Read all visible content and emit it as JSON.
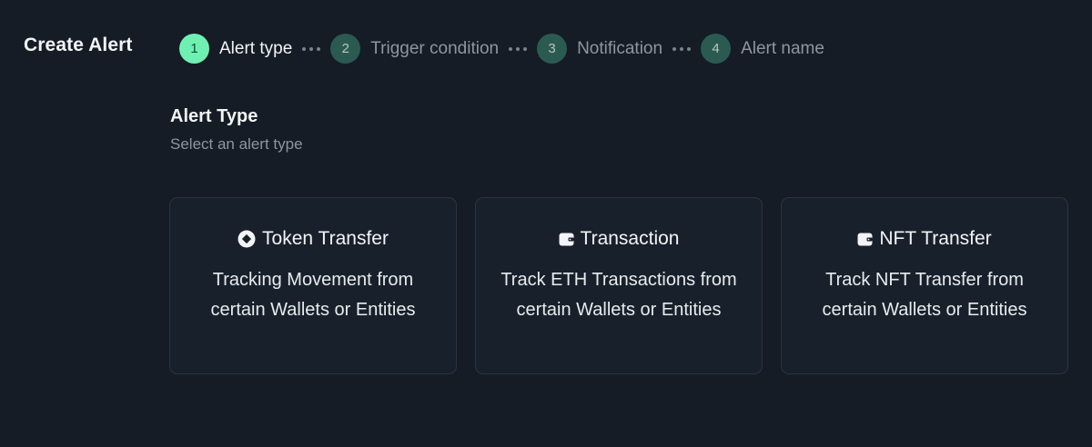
{
  "header": {
    "title": "Create Alert"
  },
  "stepper": {
    "steps": [
      {
        "number": "1",
        "label": "Alert type",
        "active": true
      },
      {
        "number": "2",
        "label": "Trigger condition",
        "active": false
      },
      {
        "number": "3",
        "label": "Notification",
        "active": false
      },
      {
        "number": "4",
        "label": "Alert name",
        "active": false
      }
    ]
  },
  "section": {
    "title": "Alert Type",
    "subtitle": "Select an alert type"
  },
  "cards": [
    {
      "icon": "token-icon",
      "title": "Token Transfer",
      "description": "Tracking Movement from certain Wallets or Entities"
    },
    {
      "icon": "wallet-icon",
      "title": "Transaction",
      "description": "Track ETH Transactions from certain Wallets or Entities"
    },
    {
      "icon": "wallet-icon",
      "title": "NFT Transfer",
      "description": "Track NFT Transfer from certain Wallets or Entities"
    }
  ],
  "colors": {
    "background": "#151c25",
    "card_background": "#18212b",
    "card_border": "#2a3440",
    "active_step": "#6ff0b3",
    "inactive_step": "#2b5a51",
    "muted_text": "#8d96a0"
  }
}
